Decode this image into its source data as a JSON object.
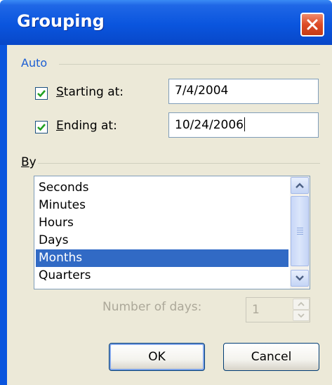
{
  "window": {
    "title": "Grouping"
  },
  "auto": {
    "group_label": "Auto",
    "starting": {
      "label_prefix": "S",
      "label_rest": "tarting at:",
      "checked": true,
      "value": "7/4/2004"
    },
    "ending": {
      "label_prefix": "E",
      "label_rest": "nding at:",
      "checked": true,
      "value": "10/24/2006"
    }
  },
  "by": {
    "group_label_prefix": "B",
    "group_label_rest": "y",
    "items": [
      "Seconds",
      "Minutes",
      "Hours",
      "Days",
      "Months",
      "Quarters"
    ],
    "selected": "Months"
  },
  "days": {
    "label": "Number of days:",
    "value": "1",
    "enabled": false
  },
  "buttons": {
    "ok": "OK",
    "cancel": "Cancel"
  },
  "colors": {
    "title_bar": "#0a55de",
    "selection": "#316ac5",
    "group_label": "#1c5ed3",
    "close": "#dd4b26"
  }
}
